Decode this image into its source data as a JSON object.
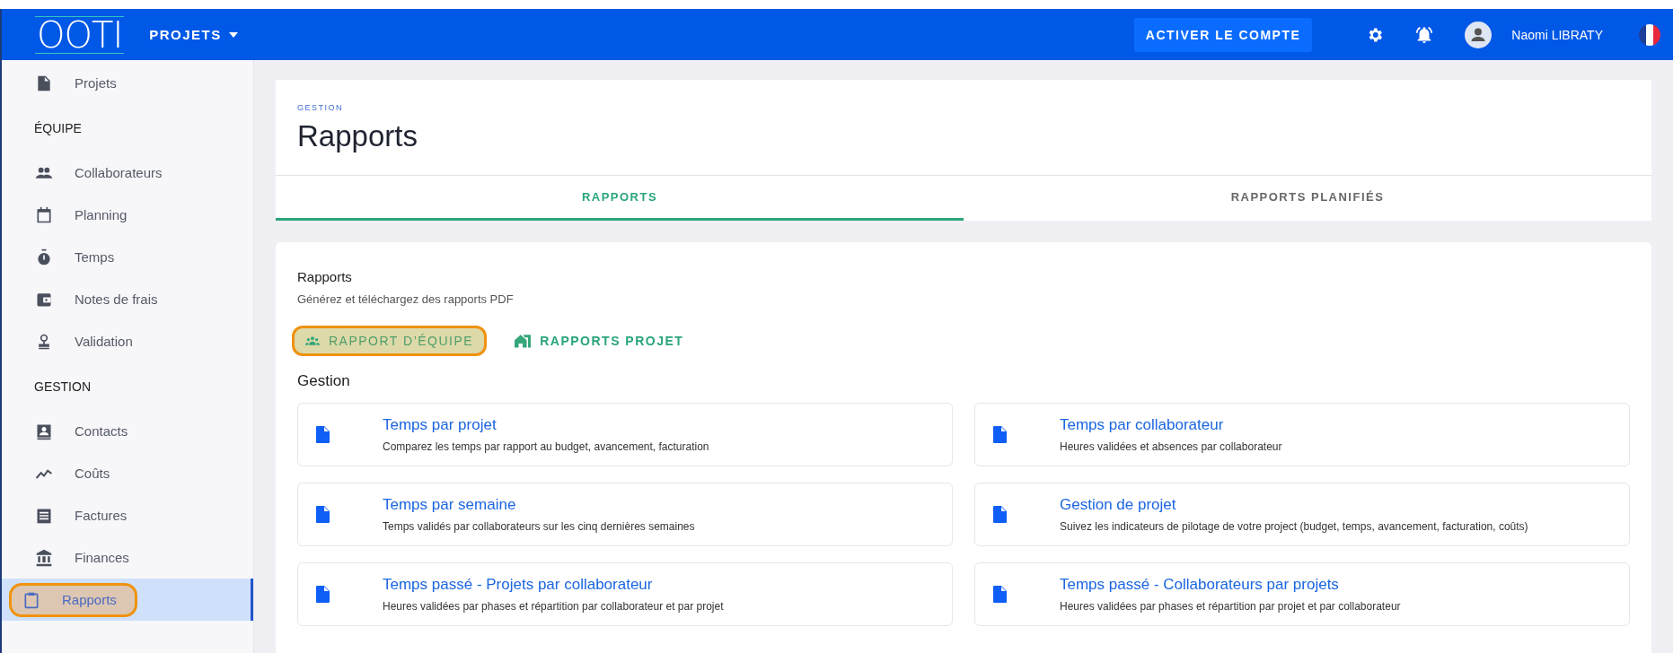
{
  "topbar": {
    "logo": "OOTI",
    "menu": "PROJETS",
    "activate_button": "ACTIVER LE COMPTE",
    "user": "Naomi LIBRATY"
  },
  "sidebar": [
    {
      "kind": "item",
      "label": "Projets",
      "selected": false
    },
    {
      "kind": "heading",
      "label": "ÉQUIPE"
    },
    {
      "kind": "item",
      "label": "Collaborateurs",
      "selected": false
    },
    {
      "kind": "item",
      "label": "Planning",
      "selected": false
    },
    {
      "kind": "item",
      "label": "Temps",
      "selected": false
    },
    {
      "kind": "item",
      "label": "Notes de frais",
      "selected": false
    },
    {
      "kind": "item",
      "label": "Validation",
      "selected": false
    },
    {
      "kind": "heading",
      "label": "GESTION"
    },
    {
      "kind": "item",
      "label": "Contacts",
      "selected": false
    },
    {
      "kind": "item",
      "label": "Coûts",
      "selected": false
    },
    {
      "kind": "item",
      "label": "Factures",
      "selected": false
    },
    {
      "kind": "item",
      "label": "Finances",
      "selected": false
    },
    {
      "kind": "item",
      "label": "Rapports",
      "selected": true
    }
  ],
  "header": {
    "breadcrumb": "GESTION",
    "title": "Rapports"
  },
  "tabs": [
    {
      "label": "RAPPORTS",
      "selected": true
    },
    {
      "label": "RAPPORTS PLANIFIÉS",
      "selected": false
    }
  ],
  "section": {
    "title": "Rapports",
    "subtitle": "Générez et téléchargez des rapports PDF"
  },
  "report_types": [
    {
      "label": "RAPPORT D’ÉQUIPE",
      "selected": true
    },
    {
      "label": "RAPPORTS PROJET",
      "selected": false
    }
  ],
  "group_title": "Gestion",
  "reports": [
    {
      "title": "Temps par projet",
      "description": "Comparez les temps par rapport au budget, avancement, facturation"
    },
    {
      "title": "Temps par collaborateur",
      "description": "Heures validées et absences par collaborateur"
    },
    {
      "title": "Temps par semaine",
      "description": "Temps validés par collaborateurs sur les cinq dernières semaines"
    },
    {
      "title": "Gestion de projet",
      "description": "Suivez les indicateurs de pilotage de votre project (budget, temps, avancement, facturation, coûts)"
    },
    {
      "title": "Temps passé - Projets par collaborateur",
      "description": "Heures validées par phases et répartition par collaborateur et par projet"
    },
    {
      "title": "Temps passé - Collaborateurs par projets",
      "description": "Heures validées par phases et répartition par projet et par collaborateur"
    }
  ]
}
